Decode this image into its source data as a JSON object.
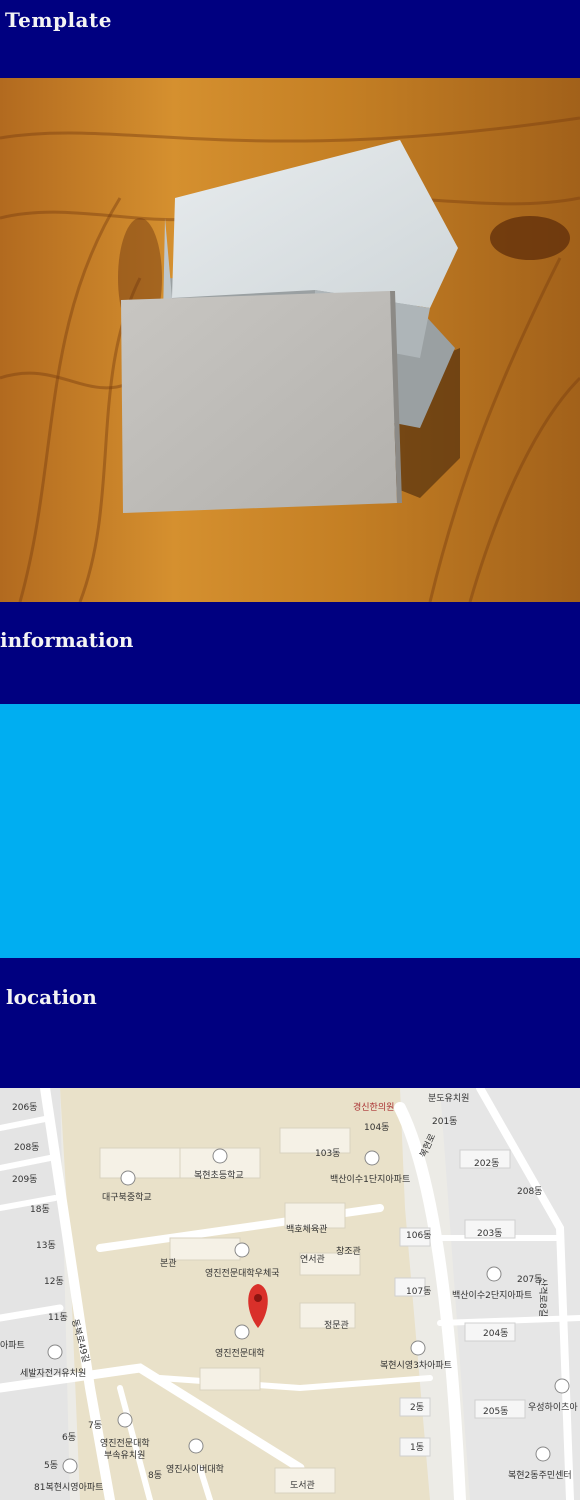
{
  "header": {
    "title": "Template"
  },
  "sections": {
    "information": {
      "title": "information"
    },
    "location": {
      "title": "location"
    }
  },
  "map": {
    "labels": [
      "206동",
      "208동",
      "209동",
      "18동",
      "13동",
      "12동",
      "11동",
      "아파트",
      "세발자전거유치원",
      "대구북중학교",
      "복현초등학교",
      "103동",
      "104동",
      "경신한의원",
      "분도유치원",
      "201동",
      "202동",
      "208동",
      "백산이수1단지아파트",
      "백호체육관",
      "창조관",
      "연서관",
      "본관",
      "영진전문대학우체국",
      "106동",
      "203동",
      "107동",
      "백산이수2단지아파트",
      "207동",
      "정문관",
      "영진전문대학",
      "204동",
      "복현시영3차아파트",
      "2동",
      "205동",
      "우성하이츠아",
      "7동",
      "6동",
      "영진전문대학",
      "부속유치원",
      "영진사이버대학",
      "8동",
      "5동",
      "1동",
      "81복현시영아파트",
      "도서관",
      "복현2동주민센터",
      "동북로49길",
      "복현로",
      "산격로8길"
    ]
  }
}
